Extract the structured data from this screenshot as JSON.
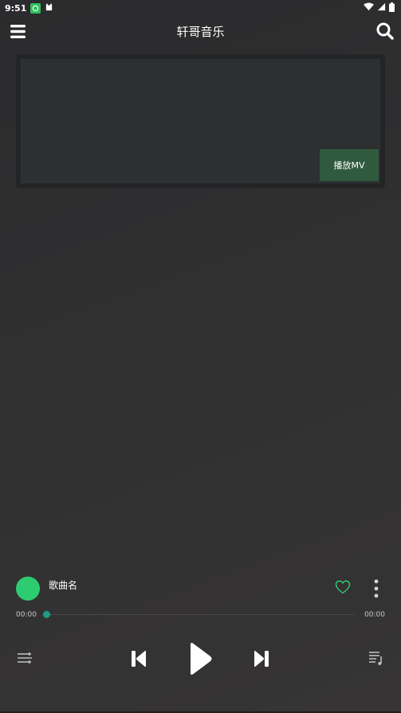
{
  "status_bar": {
    "time": "9:51"
  },
  "header": {
    "title": "轩哥音乐",
    "menu_icon": "menu-icon",
    "search_icon": "search-icon"
  },
  "video": {
    "play_mv_label": "播放MV"
  },
  "player": {
    "song_name": "歌曲名",
    "current_time": "00:00",
    "total_time": "00:00",
    "progress": 0,
    "accent_color": "#2ecc71"
  },
  "controls": {
    "icons": [
      "playlist-mode-icon",
      "previous-icon",
      "play-icon",
      "next-icon",
      "queue-icon"
    ]
  }
}
